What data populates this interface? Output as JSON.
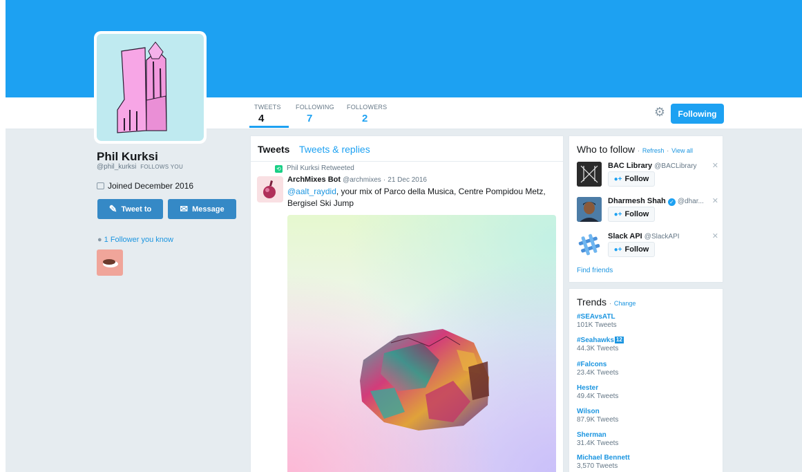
{
  "profile": {
    "name": "Phil Kurksi",
    "handle": "@phil_kurksi",
    "follows_you": "FOLLOWS YOU",
    "joined": "Joined December 2016",
    "tweet_to_label": "Tweet to",
    "message_label": "Message",
    "followers_you_know": "1 Follower you know"
  },
  "nav": {
    "stats": [
      {
        "label": "TWEETS",
        "value": "4"
      },
      {
        "label": "FOLLOWING",
        "value": "7"
      },
      {
        "label": "FOLLOWERS",
        "value": "2"
      }
    ],
    "following_button": "Following",
    "settings_icon": "gear-icon"
  },
  "timeline": {
    "tabs": [
      "Tweets",
      "Tweets & replies"
    ],
    "tweet": {
      "retweeted_by": "Phil Kurksi Retweeted",
      "author_name": "ArchMixes Bot",
      "author_handle": "@archmixes",
      "date": "21 Dec 2016",
      "mention": "@aalt_raydid",
      "text": ", your mix of Parco della Musica, Centre Pompidou Metz, Bergisel Ski Jump"
    }
  },
  "who_to_follow": {
    "title": "Who to follow",
    "refresh": "Refresh",
    "view_all": "View all",
    "follow_label": "Follow",
    "suggestions": [
      {
        "name": "BAC Library",
        "handle": "@BACLibrary"
      },
      {
        "name": "Dharmesh Shah",
        "handle": "@dhar..."
      },
      {
        "name": "Slack API",
        "handle": "@SlackAPI"
      }
    ],
    "find_friends": "Find friends"
  },
  "trends": {
    "title": "Trends",
    "change": "Change",
    "items": [
      {
        "name": "#SEAvsATL",
        "count": "101K Tweets"
      },
      {
        "name": "#Seahawks",
        "badge": "12",
        "count": "44.3K Tweets"
      },
      {
        "name": "#Falcons",
        "count": "23.4K Tweets"
      },
      {
        "name": "Hester",
        "count": "49.4K Tweets"
      },
      {
        "name": "Wilson",
        "count": "87.9K Tweets"
      },
      {
        "name": "Sherman",
        "count": "31.4K Tweets"
      },
      {
        "name": "Michael Bennett",
        "count": "3,570 Tweets"
      }
    ]
  },
  "colors": {
    "accent": "#1da1f2",
    "link": "#1b95e0",
    "button_dark": "#3589c6",
    "background": "#e6ecf0"
  }
}
